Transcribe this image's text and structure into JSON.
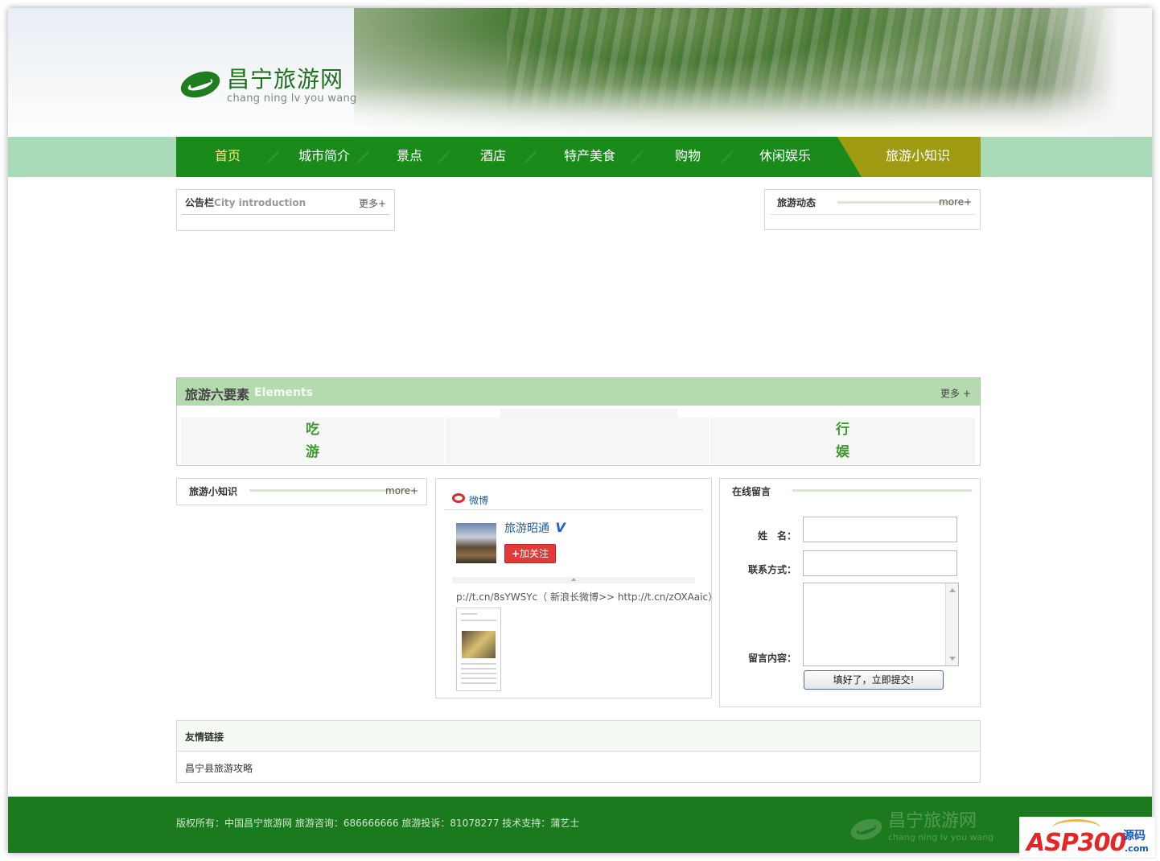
{
  "header": {
    "logo_cn": "昌宁旅游网",
    "logo_en": "chang ning lv you wang"
  },
  "nav": {
    "items": [
      "首页",
      "城市简介",
      "景点",
      "酒店",
      "特产美食",
      "购物",
      "休闲娱乐",
      "旅游小知识"
    ],
    "active_color": "#f2ef7a",
    "bar_color": "#1a8a1a",
    "last_color": "#9e9a12"
  },
  "notice": {
    "title_cn": "公告栏",
    "title_en": "City introduction",
    "more": "更多+"
  },
  "news": {
    "title": "旅游动态",
    "more": "more+"
  },
  "elements": {
    "title_cn": "旅游六要素",
    "title_en": "Elements",
    "more": "更多 +",
    "items": [
      "吃",
      "游",
      "行",
      "娱"
    ]
  },
  "tips": {
    "title": "旅游小知识",
    "more": "more+"
  },
  "weibo": {
    "label": "微博",
    "name": "旅游昭通",
    "verified": "V",
    "follow": "加关注",
    "post": "p://t.cn/8sYWSYc（ 新浪长微博>> http://t.cn/zOXAaic）"
  },
  "message": {
    "title": "在线留言",
    "name_label": "姓　名：",
    "contact_label": "联系方式：",
    "content_label": "留言内容：",
    "submit": "填好了，立即提交!"
  },
  "links": {
    "title": "友情链接",
    "items": [
      "昌宁县旅游攻略"
    ]
  },
  "footer": {
    "text": "版权所有：中国昌宁旅游网 旅游咨询：686666666 旅游投诉：81078277 技术支持：蒲艺士",
    "logo_cn": "昌宁旅游网",
    "logo_en": "chang ning lv you wang"
  },
  "watermark": {
    "brand": "ASP300",
    "suffix": "源码",
    "domain": ".com"
  }
}
